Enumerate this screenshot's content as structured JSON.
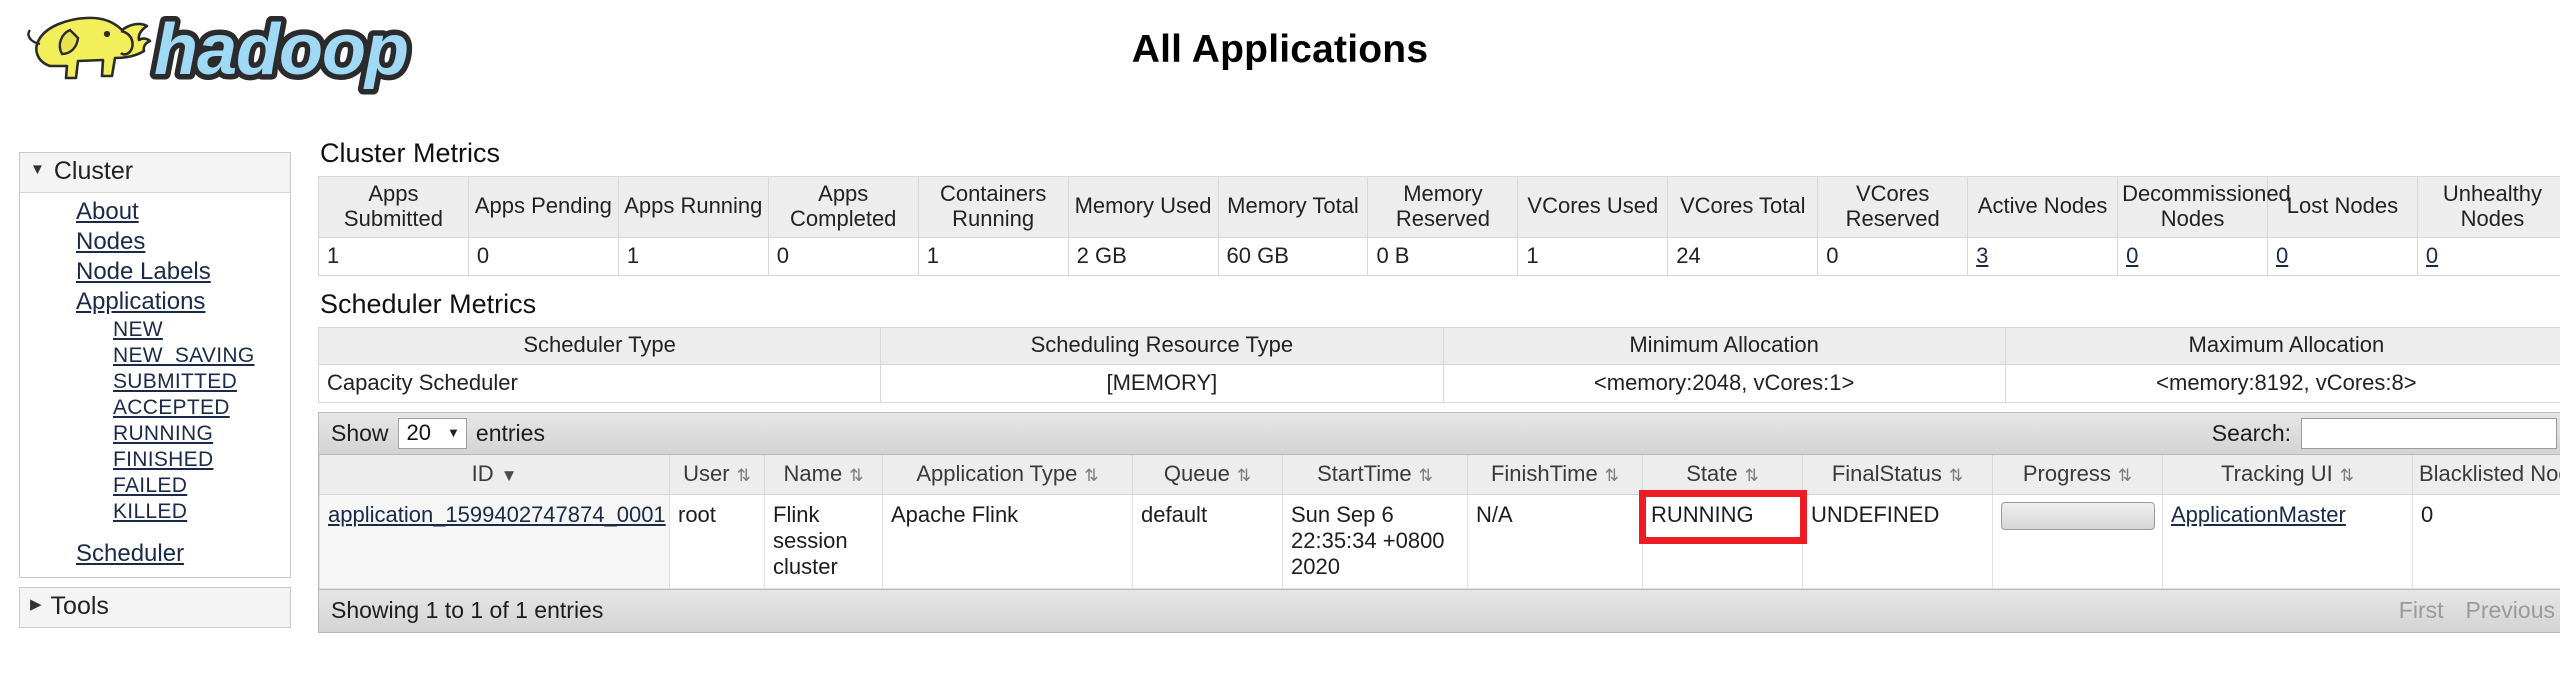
{
  "header": {
    "logo_alt": "hadoop",
    "page_title": "All Applications"
  },
  "sidebar": {
    "cluster": {
      "label": "Cluster",
      "items": [
        {
          "label": "About"
        },
        {
          "label": "Nodes"
        },
        {
          "label": "Node Labels"
        },
        {
          "label": "Applications"
        }
      ],
      "app_states": [
        {
          "label": "NEW"
        },
        {
          "label": "NEW_SAVING"
        },
        {
          "label": "SUBMITTED"
        },
        {
          "label": "ACCEPTED"
        },
        {
          "label": "RUNNING"
        },
        {
          "label": "FINISHED"
        },
        {
          "label": "FAILED"
        },
        {
          "label": "KILLED"
        }
      ],
      "scheduler_label": "Scheduler"
    },
    "tools": {
      "label": "Tools"
    }
  },
  "cluster_metrics": {
    "title": "Cluster Metrics",
    "headers": [
      "Apps Submitted",
      "Apps Pending",
      "Apps Running",
      "Apps Completed",
      "Containers Running",
      "Memory Used",
      "Memory Total",
      "Memory Reserved",
      "VCores Used",
      "VCores Total",
      "VCores Reserved",
      "Active Nodes",
      "Decommissioned Nodes",
      "Lost Nodes",
      "Unhealthy Nodes"
    ],
    "values": [
      "1",
      "0",
      "1",
      "0",
      "1",
      "2 GB",
      "60 GB",
      "0 B",
      "1",
      "24",
      "0",
      "3",
      "0",
      "0",
      "0"
    ],
    "linked_value_indices": [
      11,
      12,
      13,
      14
    ]
  },
  "scheduler_metrics": {
    "title": "Scheduler Metrics",
    "headers": [
      "Scheduler Type",
      "Scheduling Resource Type",
      "Minimum Allocation",
      "Maximum Allocation"
    ],
    "values": [
      "Capacity Scheduler",
      "[MEMORY]",
      "<memory:2048, vCores:1>",
      "<memory:8192, vCores:8>"
    ]
  },
  "apps_table": {
    "show_label": "Show",
    "page_size": "20",
    "entries_label": "entries",
    "search_label": "Search:",
    "search_value": "",
    "headers": [
      {
        "label": "ID",
        "sort": "desc"
      },
      {
        "label": "User",
        "sort": "both"
      },
      {
        "label": "Name",
        "sort": "both"
      },
      {
        "label": "Application Type",
        "sort": "both"
      },
      {
        "label": "Queue",
        "sort": "both"
      },
      {
        "label": "StartTime",
        "sort": "both"
      },
      {
        "label": "FinishTime",
        "sort": "both"
      },
      {
        "label": "State",
        "sort": "both"
      },
      {
        "label": "FinalStatus",
        "sort": "both"
      },
      {
        "label": "Progress",
        "sort": "both"
      },
      {
        "label": "Tracking UI",
        "sort": "both"
      },
      {
        "label": "Blacklisted Nodes",
        "sort": "both"
      }
    ],
    "rows": [
      {
        "id": "application_1599402747874_0001",
        "user": "root",
        "name": "Flink session cluster",
        "application_type": "Apache Flink",
        "queue": "default",
        "start_time": "Sun Sep 6 22:35:34 +0800 2020",
        "finish_time": "N/A",
        "state": "RUNNING",
        "final_status": "UNDEFINED",
        "progress": "0",
        "tracking_ui": "ApplicationMaster",
        "blacklisted_nodes": "0"
      }
    ],
    "footer_status": "Showing 1 to 1 of 1 entries",
    "pager": [
      "First",
      "Previous"
    ]
  },
  "annotation": {
    "target": "RUNNING",
    "color": "#ee1c25"
  }
}
